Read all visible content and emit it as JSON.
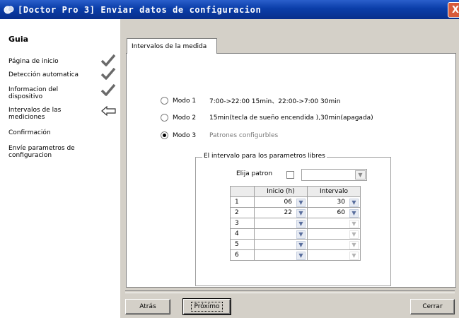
{
  "window": {
    "title": "[Doctor Pro 3] Enviar datos de configuracion",
    "close_glyph": "X",
    "accent_color": "#0a3da8"
  },
  "sidebar": {
    "title": "Guia",
    "steps": [
      {
        "label": "Página de inicio",
        "state": "done",
        "icon": "checkmark-icon"
      },
      {
        "label": "Detección automatica",
        "state": "done",
        "icon": "checkmark-icon"
      },
      {
        "label": "Informacion del dispositivo",
        "state": "done",
        "icon": "checkmark-icon"
      },
      {
        "label": "Intervalos de las mediciones",
        "state": "current",
        "icon": "arrow-left-icon"
      },
      {
        "label": "Confirmación",
        "state": "pending",
        "icon": ""
      },
      {
        "label": "Envíe parametros de configuracion",
        "state": "pending",
        "icon": ""
      }
    ]
  },
  "tab": {
    "label": "Intervalos de la medida"
  },
  "modes": [
    {
      "label": "Modo 1",
      "description": "7:00->22:00 15min、22:00->7:00 30min",
      "selected": false,
      "dim": false
    },
    {
      "label": "Modo 2",
      "description": "15min(tecla de sueño encendida ),30min(apagada)",
      "selected": false,
      "dim": false
    },
    {
      "label": "Modo 3",
      "description": "Patrones configurbles",
      "selected": true,
      "dim": true
    }
  ],
  "free_params": {
    "legend": "El intervalo para los parametros libres",
    "pattern_label": "Elija patron",
    "pattern_checked": false,
    "pattern_value": "",
    "columns": [
      "Inicio (h)",
      "Intervalo"
    ],
    "rows": [
      {
        "num": "1",
        "inicio": "06",
        "intervalo": "30"
      },
      {
        "num": "2",
        "inicio": "22",
        "intervalo": "60"
      },
      {
        "num": "3",
        "inicio": "",
        "intervalo": ""
      },
      {
        "num": "4",
        "inicio": "",
        "intervalo": ""
      },
      {
        "num": "5",
        "inicio": "",
        "intervalo": ""
      },
      {
        "num": "6",
        "inicio": "",
        "intervalo": ""
      }
    ]
  },
  "buttons": {
    "back": "Atrás",
    "next": "Próximo",
    "cancel": "Cerrar"
  }
}
